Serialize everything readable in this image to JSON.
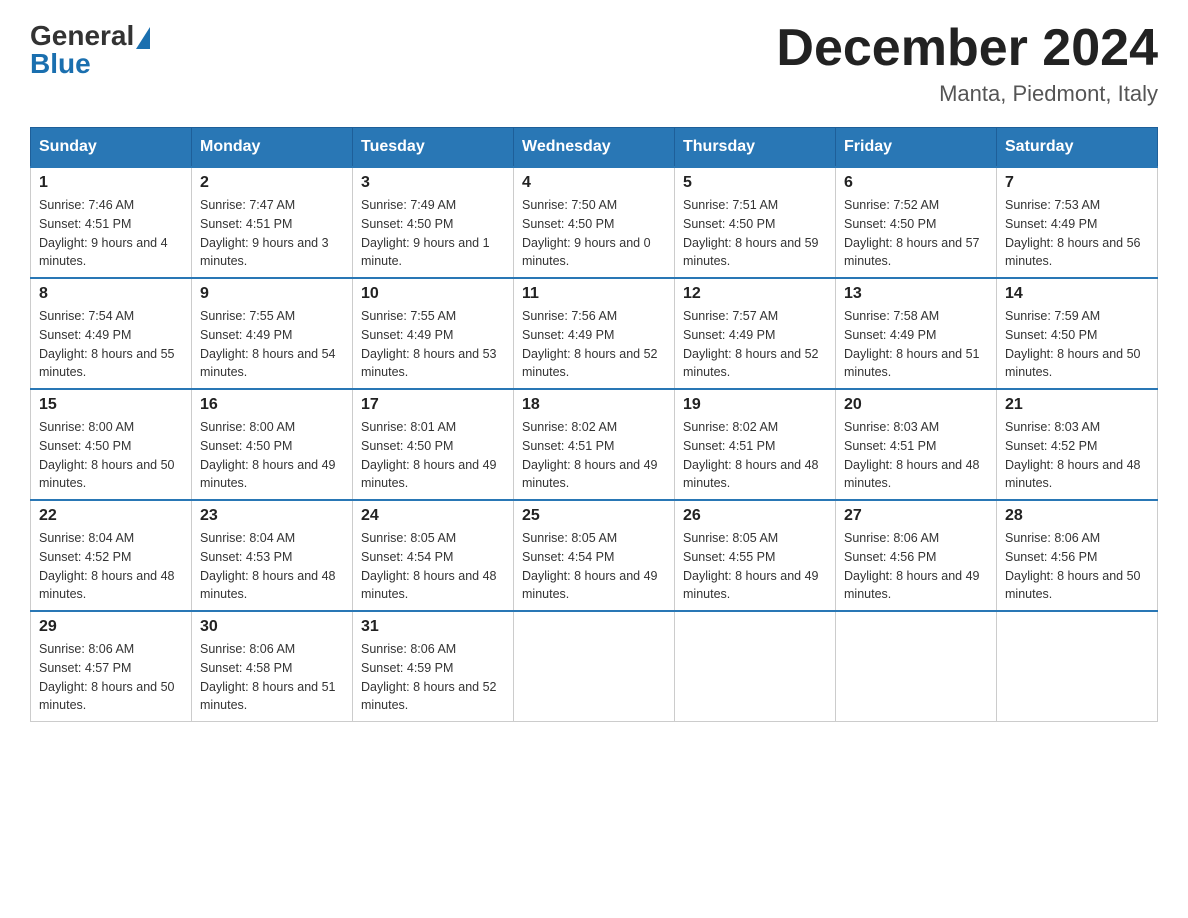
{
  "logo": {
    "general": "General",
    "blue": "Blue"
  },
  "title": "December 2024",
  "location": "Manta, Piedmont, Italy",
  "days_of_week": [
    "Sunday",
    "Monday",
    "Tuesday",
    "Wednesday",
    "Thursday",
    "Friday",
    "Saturday"
  ],
  "weeks": [
    [
      {
        "day": "1",
        "sunrise": "7:46 AM",
        "sunset": "4:51 PM",
        "daylight": "9 hours and 4 minutes."
      },
      {
        "day": "2",
        "sunrise": "7:47 AM",
        "sunset": "4:51 PM",
        "daylight": "9 hours and 3 minutes."
      },
      {
        "day": "3",
        "sunrise": "7:49 AM",
        "sunset": "4:50 PM",
        "daylight": "9 hours and 1 minute."
      },
      {
        "day": "4",
        "sunrise": "7:50 AM",
        "sunset": "4:50 PM",
        "daylight": "9 hours and 0 minutes."
      },
      {
        "day": "5",
        "sunrise": "7:51 AM",
        "sunset": "4:50 PM",
        "daylight": "8 hours and 59 minutes."
      },
      {
        "day": "6",
        "sunrise": "7:52 AM",
        "sunset": "4:50 PM",
        "daylight": "8 hours and 57 minutes."
      },
      {
        "day": "7",
        "sunrise": "7:53 AM",
        "sunset": "4:49 PM",
        "daylight": "8 hours and 56 minutes."
      }
    ],
    [
      {
        "day": "8",
        "sunrise": "7:54 AM",
        "sunset": "4:49 PM",
        "daylight": "8 hours and 55 minutes."
      },
      {
        "day": "9",
        "sunrise": "7:55 AM",
        "sunset": "4:49 PM",
        "daylight": "8 hours and 54 minutes."
      },
      {
        "day": "10",
        "sunrise": "7:55 AM",
        "sunset": "4:49 PM",
        "daylight": "8 hours and 53 minutes."
      },
      {
        "day": "11",
        "sunrise": "7:56 AM",
        "sunset": "4:49 PM",
        "daylight": "8 hours and 52 minutes."
      },
      {
        "day": "12",
        "sunrise": "7:57 AM",
        "sunset": "4:49 PM",
        "daylight": "8 hours and 52 minutes."
      },
      {
        "day": "13",
        "sunrise": "7:58 AM",
        "sunset": "4:49 PM",
        "daylight": "8 hours and 51 minutes."
      },
      {
        "day": "14",
        "sunrise": "7:59 AM",
        "sunset": "4:50 PM",
        "daylight": "8 hours and 50 minutes."
      }
    ],
    [
      {
        "day": "15",
        "sunrise": "8:00 AM",
        "sunset": "4:50 PM",
        "daylight": "8 hours and 50 minutes."
      },
      {
        "day": "16",
        "sunrise": "8:00 AM",
        "sunset": "4:50 PM",
        "daylight": "8 hours and 49 minutes."
      },
      {
        "day": "17",
        "sunrise": "8:01 AM",
        "sunset": "4:50 PM",
        "daylight": "8 hours and 49 minutes."
      },
      {
        "day": "18",
        "sunrise": "8:02 AM",
        "sunset": "4:51 PM",
        "daylight": "8 hours and 49 minutes."
      },
      {
        "day": "19",
        "sunrise": "8:02 AM",
        "sunset": "4:51 PM",
        "daylight": "8 hours and 48 minutes."
      },
      {
        "day": "20",
        "sunrise": "8:03 AM",
        "sunset": "4:51 PM",
        "daylight": "8 hours and 48 minutes."
      },
      {
        "day": "21",
        "sunrise": "8:03 AM",
        "sunset": "4:52 PM",
        "daylight": "8 hours and 48 minutes."
      }
    ],
    [
      {
        "day": "22",
        "sunrise": "8:04 AM",
        "sunset": "4:52 PM",
        "daylight": "8 hours and 48 minutes."
      },
      {
        "day": "23",
        "sunrise": "8:04 AM",
        "sunset": "4:53 PM",
        "daylight": "8 hours and 48 minutes."
      },
      {
        "day": "24",
        "sunrise": "8:05 AM",
        "sunset": "4:54 PM",
        "daylight": "8 hours and 48 minutes."
      },
      {
        "day": "25",
        "sunrise": "8:05 AM",
        "sunset": "4:54 PM",
        "daylight": "8 hours and 49 minutes."
      },
      {
        "day": "26",
        "sunrise": "8:05 AM",
        "sunset": "4:55 PM",
        "daylight": "8 hours and 49 minutes."
      },
      {
        "day": "27",
        "sunrise": "8:06 AM",
        "sunset": "4:56 PM",
        "daylight": "8 hours and 49 minutes."
      },
      {
        "day": "28",
        "sunrise": "8:06 AM",
        "sunset": "4:56 PM",
        "daylight": "8 hours and 50 minutes."
      }
    ],
    [
      {
        "day": "29",
        "sunrise": "8:06 AM",
        "sunset": "4:57 PM",
        "daylight": "8 hours and 50 minutes."
      },
      {
        "day": "30",
        "sunrise": "8:06 AM",
        "sunset": "4:58 PM",
        "daylight": "8 hours and 51 minutes."
      },
      {
        "day": "31",
        "sunrise": "8:06 AM",
        "sunset": "4:59 PM",
        "daylight": "8 hours and 52 minutes."
      },
      null,
      null,
      null,
      null
    ]
  ]
}
